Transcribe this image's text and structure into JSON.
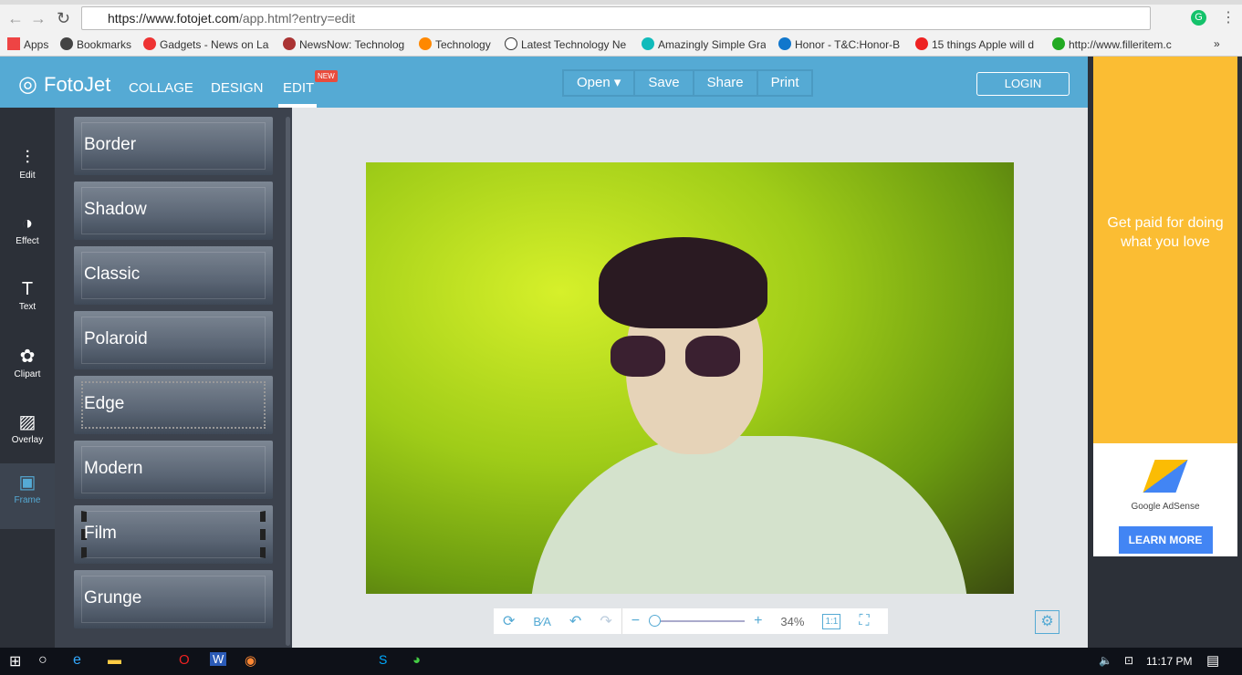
{
  "browser": {
    "url_host": "https://www.fotojet.com",
    "url_path": "/app.html?entry=edit",
    "bookmarks": [
      "Apps",
      "Bookmarks",
      "Gadgets - News on La",
      "NewsNow: Technolog",
      "Technology",
      "Latest Technology Ne",
      "Amazingly Simple Gra",
      "Honor - T&C:Honor-B",
      "15 things Apple will d",
      "http://www.filleritem.c"
    ],
    "more": "»"
  },
  "app": {
    "logo": "FotoJet",
    "nav": [
      "COLLAGE",
      "DESIGN",
      "EDIT"
    ],
    "new_badge": "NEW",
    "actions": [
      "Open ▾",
      "Save",
      "Share",
      "Print"
    ],
    "login": "LOGIN",
    "rail": [
      {
        "icon": "sliders-icon",
        "g": "⫶",
        "label": "Edit"
      },
      {
        "icon": "effect-icon",
        "g": "◑",
        "label": "Effect"
      },
      {
        "icon": "text-icon",
        "g": "T",
        "label": "Text"
      },
      {
        "icon": "clipart-icon",
        "g": "✿",
        "label": "Clipart"
      },
      {
        "icon": "overlay-icon",
        "g": "▨",
        "label": "Overlay"
      },
      {
        "icon": "frame-icon",
        "g": "▣",
        "label": "Frame"
      }
    ],
    "frames": [
      "Border",
      "Shadow",
      "Classic",
      "Polaroid",
      "Edge",
      "Modern",
      "Film",
      "Grunge"
    ],
    "zoom": "34%",
    "zoom_fit": "1:1",
    "zoom_level_percent": 34
  },
  "ad": {
    "headline": "Get paid for doing what you love",
    "brand": "Google AdSense",
    "cta": "LEARN MORE",
    "colors": {
      "yellow": "#fbbd33",
      "button": "#4285f4"
    }
  },
  "taskbar": {
    "time": "11:17 PM"
  },
  "colors": {
    "header": "#55aad4",
    "rail": "#2c3038"
  }
}
